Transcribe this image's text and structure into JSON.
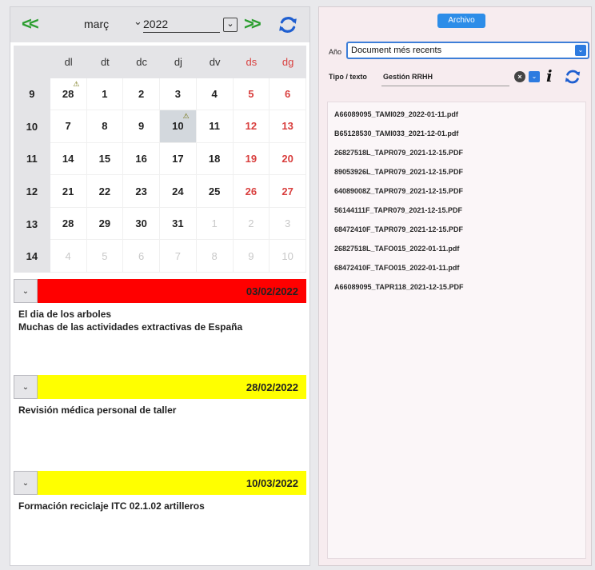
{
  "calendar": {
    "month": "març",
    "year": "2022",
    "prev_label": "<<",
    "next_label": ">>",
    "weekdays": [
      "dl",
      "dt",
      "dc",
      "dj",
      "dv",
      "ds",
      "dg"
    ],
    "weeks": [
      {
        "week": "9",
        "days": [
          "28",
          "1",
          "2",
          "3",
          "4",
          "5",
          "6"
        ]
      },
      {
        "week": "10",
        "days": [
          "7",
          "8",
          "9",
          "10",
          "11",
          "12",
          "13"
        ]
      },
      {
        "week": "11",
        "days": [
          "14",
          "15",
          "16",
          "17",
          "18",
          "19",
          "20"
        ]
      },
      {
        "week": "12",
        "days": [
          "21",
          "22",
          "23",
          "24",
          "25",
          "26",
          "27"
        ]
      },
      {
        "week": "13",
        "days": [
          "28",
          "29",
          "30",
          "31",
          "1",
          "2",
          "3"
        ]
      },
      {
        "week": "14",
        "days": [
          "4",
          "5",
          "6",
          "7",
          "8",
          "9",
          "10"
        ]
      }
    ],
    "warning_symbol": "⚠",
    "colors": {
      "weekend": "#d9403f",
      "nav": "#2c9e30",
      "refresh": "#1f5fd0"
    }
  },
  "events": [
    {
      "date": "03/02/2022",
      "color": "#ff0000",
      "lines": [
        "El dia de los arboles",
        "Muchas de las actividades extractivas de España"
      ],
      "button": "⌄"
    },
    {
      "date": "28/02/2022",
      "color": "#ffff00",
      "lines": [
        "Revisión médica personal de taller"
      ],
      "button": "⌄"
    },
    {
      "date": "10/03/2022",
      "color": "#ffff00",
      "lines": [
        "Formación reciclaje ITC 02.1.02 artilleros"
      ],
      "button": "⌄"
    }
  ],
  "archive": {
    "button_label": "Archivo",
    "ano_label": "Año",
    "ano_value": "Document més recents",
    "tipo_label": "Tipo / texto",
    "tipo_value": "Gestión RRHH",
    "info_label": "i",
    "files": [
      "A66089095_TAMI029_2022-01-11.pdf",
      "B65128530_TAMI033_2021-12-01.pdf",
      "26827518L_TAPR079_2021-12-15.PDF",
      "89053926L_TAPR079_2021-12-15.PDF",
      "64089008Z_TAPR079_2021-12-15.PDF",
      "56144111F_TAPR079_2021-12-15.PDF",
      "68472410F_TAPR079_2021-12-15.PDF",
      "26827518L_TAFO015_2022-01-11.pdf",
      "68472410F_TAFO015_2022-01-11.pdf",
      "A66089095_TAPR118_2021-12-15.PDF"
    ]
  }
}
